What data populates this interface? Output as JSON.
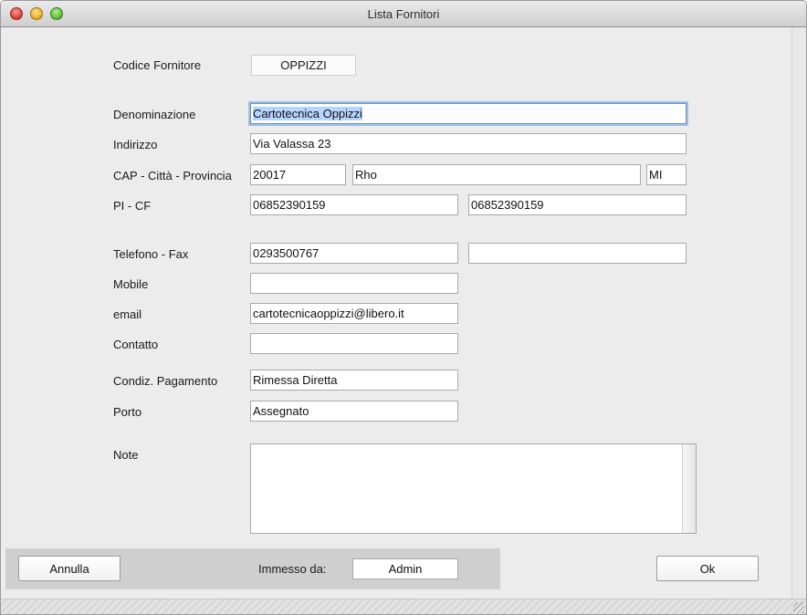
{
  "window": {
    "title": "Lista Fornitori"
  },
  "form": {
    "codice_fornitore": {
      "label": "Codice Fornitore",
      "value": "OPPIZZI"
    },
    "denominazione": {
      "label": "Denominazione",
      "value": "Cartotecnica Oppizzi"
    },
    "indirizzo": {
      "label": "Indirizzo",
      "value": "Via Valassa 23"
    },
    "cap_citta_provincia": {
      "label": "CAP - Città - Provincia",
      "cap": "20017",
      "citta": "Rho",
      "provincia": "MI"
    },
    "pi_cf": {
      "label": "PI - CF",
      "pi": "06852390159",
      "cf": "06852390159"
    },
    "telefono_fax": {
      "label": "Telefono - Fax",
      "telefono": "0293500767",
      "fax": ""
    },
    "mobile": {
      "label": "Mobile",
      "value": ""
    },
    "email": {
      "label": "email",
      "value": "cartotecnicaoppizzi@libero.it"
    },
    "contatto": {
      "label": "Contatto",
      "value": ""
    },
    "condiz_pagamento": {
      "label": "Condiz. Pagamento",
      "value": "Rimessa Diretta"
    },
    "porto": {
      "label": "Porto",
      "value": "Assegnato"
    },
    "note": {
      "label": "Note",
      "value": ""
    }
  },
  "footer": {
    "annulla_label": "Annulla",
    "immesso_da_label": "Immesso da:",
    "immesso_da_value": "Admin",
    "ok_label": "Ok"
  }
}
